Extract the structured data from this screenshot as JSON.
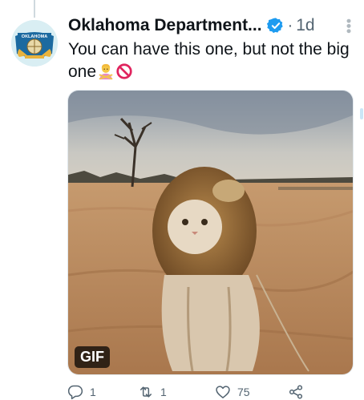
{
  "tweet": {
    "author_name": "Oklahoma Department...",
    "verified": true,
    "separator": "·",
    "timestamp": "1d",
    "text": "You can have this one, but not the big one",
    "emojis": [
      "person-gesturing-no-emoji",
      "prohibited-emoji"
    ],
    "avatar_text": "OKLAHOMA"
  },
  "media": {
    "type": "gif",
    "badge": "GIF",
    "description_icon": "cat-in-lion-mane-gif"
  },
  "actions": {
    "reply_count": "1",
    "retweet_count": "1",
    "like_count": "75"
  },
  "colors": {
    "accent": "#1d9bf0",
    "text": "#0f1419",
    "muted": "#536471"
  }
}
